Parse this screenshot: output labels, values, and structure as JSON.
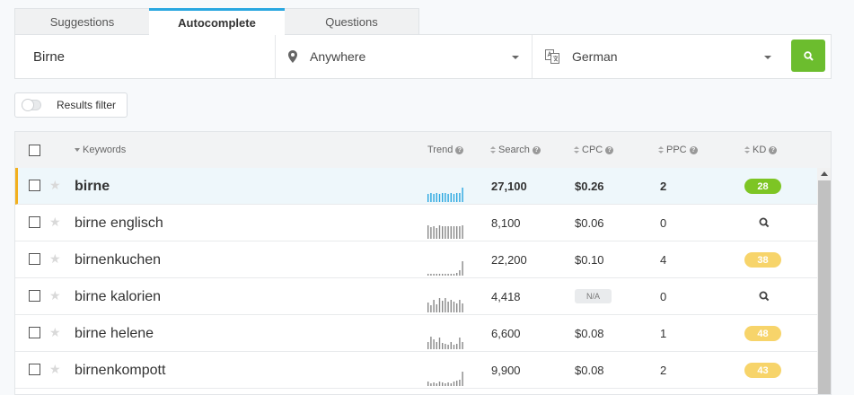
{
  "tabs": [
    {
      "label": "Suggestions"
    },
    {
      "label": "Autocomplete"
    },
    {
      "label": "Questions"
    }
  ],
  "search": {
    "keyword": "Birne",
    "location": "Anywhere",
    "language": "German"
  },
  "filter": {
    "label": "Results filter"
  },
  "colors": {
    "accent": "#2aa7e0",
    "button": "#6cbd2e",
    "kd_green": "#7dc524",
    "kd_yellow": "#f7d46a",
    "selected_border": "#f2b01e"
  },
  "table": {
    "headers": {
      "keywords": "Keywords",
      "trend": "Trend",
      "search": "Search",
      "cpc": "CPC",
      "ppc": "PPC",
      "kd": "KD"
    },
    "rows": [
      {
        "keyword": "birne",
        "search": "27,100",
        "cpc": "$0.26",
        "ppc": "2",
        "kd": "28",
        "kd_color": "green",
        "trend": [
          0.55,
          0.6,
          0.55,
          0.6,
          0.55,
          0.6,
          0.6,
          0.55,
          0.6,
          0.55,
          0.6,
          0.65,
          1.0
        ]
      },
      {
        "keyword": "birne englisch",
        "search": "8,100",
        "cpc": "$0.06",
        "ppc": "0",
        "kd": "",
        "kd_color": "search",
        "trend": [
          0.95,
          0.8,
          0.85,
          0.75,
          0.95,
          0.85,
          0.9,
          0.85,
          0.9,
          0.85,
          0.9,
          0.85,
          0.95
        ]
      },
      {
        "keyword": "birnenkuchen",
        "search": "22,200",
        "cpc": "$0.10",
        "ppc": "4",
        "kd": "38",
        "kd_color": "yellow",
        "trend": [
          0.15,
          0.1,
          0.15,
          0.1,
          0.1,
          0.15,
          0.1,
          0.15,
          0.1,
          0.15,
          0.2,
          0.35,
          1.0
        ]
      },
      {
        "keyword": "birne kalorien",
        "search": "4,418",
        "cpc": "N/A",
        "ppc": "0",
        "kd": "",
        "kd_color": "search",
        "trend": [
          0.7,
          0.5,
          0.9,
          0.55,
          1.0,
          0.8,
          1.0,
          0.75,
          0.9,
          0.75,
          0.6,
          0.9,
          0.65
        ]
      },
      {
        "keyword": "birne helene",
        "search": "6,600",
        "cpc": "$0.08",
        "ppc": "1",
        "kd": "48",
        "kd_color": "yellow",
        "trend": [
          0.5,
          0.9,
          0.7,
          0.5,
          0.8,
          0.45,
          0.35,
          0.3,
          0.5,
          0.3,
          0.35,
          0.8,
          0.5
        ]
      },
      {
        "keyword": "birnenkompott",
        "search": "9,900",
        "cpc": "$0.08",
        "ppc": "2",
        "kd": "43",
        "kd_color": "yellow",
        "trend": [
          0.3,
          0.2,
          0.25,
          0.2,
          0.3,
          0.25,
          0.2,
          0.25,
          0.2,
          0.3,
          0.35,
          0.45,
          1.0
        ]
      }
    ]
  }
}
